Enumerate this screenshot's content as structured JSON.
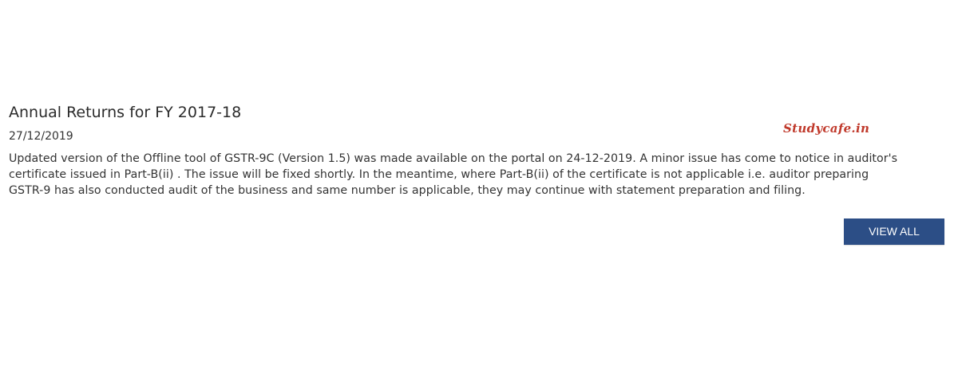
{
  "notice": {
    "title": "Annual Returns for FY 2017-18",
    "date": "27/12/2019",
    "body_lines": [
      "Updated version of the Offline tool of GSTR-9C (Version 1.5) was made available on the portal on 24-12-2019. A minor issue has come to notice in auditor's",
      "certificate issued in Part-B(ii) . The issue will be fixed shortly. In the meantime, where Part-B(ii) of the certificate is not applicable i.e. auditor preparing",
      "GSTR-9 has also conducted audit of the business and same number is applicable, they may continue with statement preparation and filing."
    ]
  },
  "watermark": {
    "text": "Studycafe.in",
    "color": "#c0392b"
  },
  "actions": {
    "view_all_label": "VIEW ALL",
    "button_color": "#2c4e86"
  }
}
